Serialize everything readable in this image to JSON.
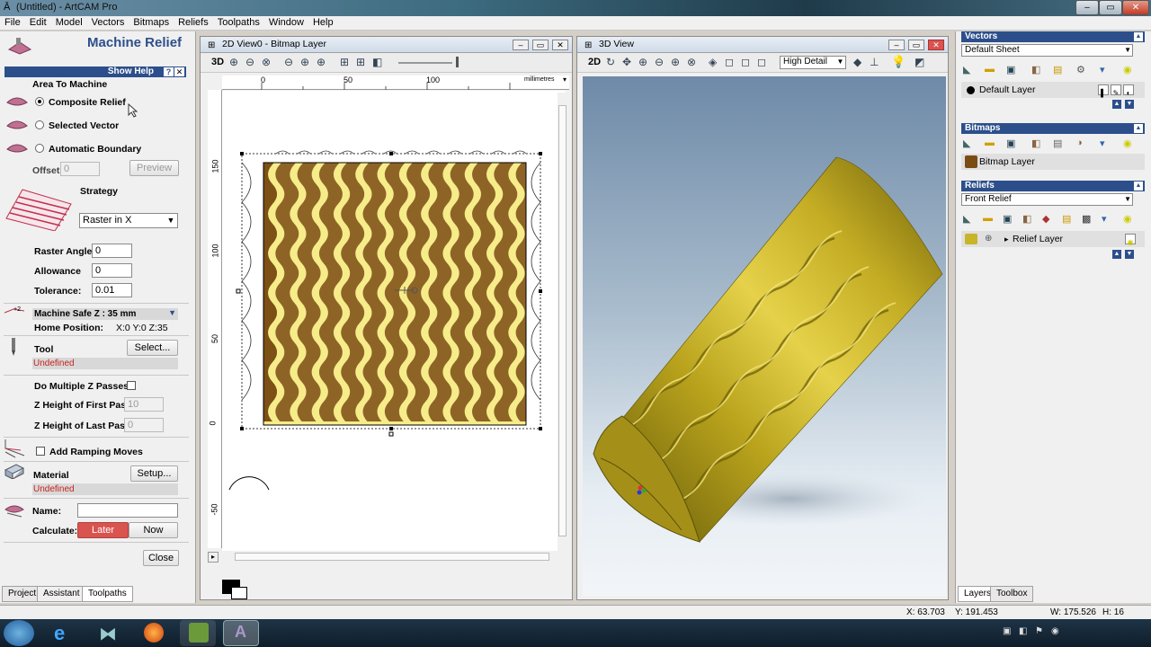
{
  "window": {
    "title": "(Untitled) - ArtCAM Pro"
  },
  "menu": [
    "File",
    "Edit",
    "Model",
    "Vectors",
    "Bitmaps",
    "Reliefs",
    "Toolpaths",
    "Window",
    "Help"
  ],
  "machine_relief": {
    "title": "Machine Relief",
    "show_help": "Show Help",
    "area_label": "Area To Machine",
    "options": [
      "Composite Relief",
      "Selected Vector",
      "Automatic Boundary"
    ],
    "offset_label": "Offset",
    "offset_value": "0",
    "preview_label": "Preview",
    "strategy_label": "Strategy",
    "strategy_value": "Raster in X",
    "raster_angle_label": "Raster Angle:",
    "raster_angle_value": "0",
    "allowance_label": "Allowance",
    "allowance_value": "0",
    "tolerance_label": "Tolerance:",
    "tolerance_value": "0.01",
    "safe_z": "Machine Safe Z : 35 mm",
    "home_label": "Home Position:",
    "home_value": "X:0 Y:0 Z:35",
    "tool_label": "Tool",
    "select_label": "Select...",
    "tool_value": "Undefined",
    "multi_z": "Do Multiple Z Passes",
    "z_first_label": "Z Height of First Pass",
    "z_first_value": "10",
    "z_last_label": "Z Height of Last Pass",
    "z_last_value": "0",
    "ramping": "Add Ramping Moves",
    "material_label": "Material",
    "setup_label": "Setup...",
    "material_value": "Undefined",
    "name_label": "Name:",
    "calc_label": "Calculate:",
    "later_label": "Later",
    "now_label": "Now",
    "close_label": "Close"
  },
  "left_tabs": [
    "Project",
    "Assistant",
    "Toolpaths"
  ],
  "view2d": {
    "title": "2D View0 - Bitmap Layer",
    "mode_btn": "3D",
    "ruler_h": [
      "0",
      "50",
      "100"
    ],
    "ruler_unit": "millimetres",
    "ruler_v": [
      "150",
      "100",
      "50",
      "0",
      "-50"
    ]
  },
  "view3d": {
    "title": "3D View",
    "mode_btn": "2D",
    "detail": "High Detail"
  },
  "right": {
    "vectors_hdr": "Vectors",
    "vectors_sheet": "Default Sheet",
    "vectors_layer": "Default Layer",
    "bitmaps_hdr": "Bitmaps",
    "bitmap_layer": "Bitmap Layer",
    "reliefs_hdr": "Reliefs",
    "reliefs_sel": "Front Relief",
    "relief_layer": "Relief Layer"
  },
  "right_tabs": [
    "Layers",
    "Toolbox"
  ],
  "status": {
    "x": "X: 63.703",
    "y": "Y: 191.453",
    "w": "W: 175.526",
    "h": "H: 16"
  },
  "colors": {
    "relief_gold": "#c8b428",
    "selected_accent": "#2c4f8c",
    "later_button": "#d9534f"
  }
}
